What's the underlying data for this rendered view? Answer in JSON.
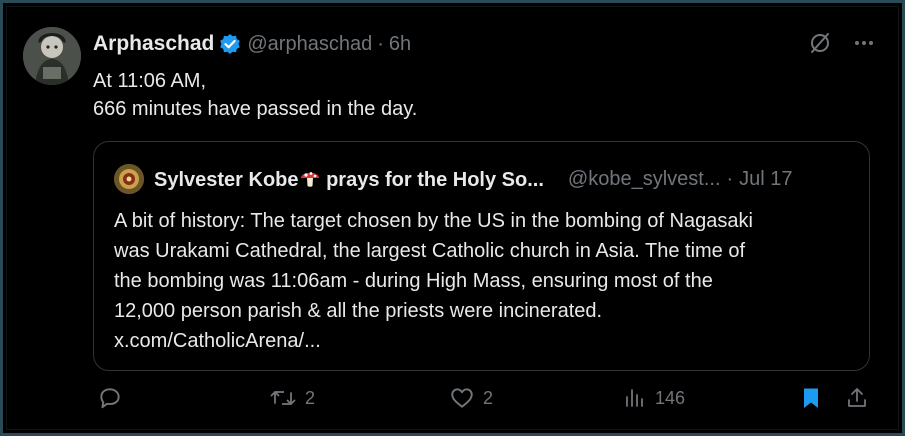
{
  "post": {
    "display_name": "Arphaschad",
    "handle": "@arphaschad",
    "separator": "·",
    "time": "6h",
    "text_line1": "At 11:06 AM,",
    "text_line2": "666 minutes have passed in the day."
  },
  "quote": {
    "display_name_before": "Sylvester Kobe",
    "display_name_after": " prays for the Holy So...",
    "handle": "@kobe_sylvest...",
    "separator": "·",
    "date": "Jul 17",
    "lines": [
      "A bit of history: The target chosen by the US in the bombing of Nagasaki",
      "was Urakami Cathedral, the largest Catholic church in Asia.  The time of",
      "the bombing was 11:06am - during High Mass, ensuring most of the",
      "12,000 person parish & all the priests were incinerated.",
      "x.com/CatholicArena/..."
    ]
  },
  "actions": {
    "reply_count": "",
    "repost_count": "2",
    "like_count": "2",
    "views_count": "146"
  },
  "colors": {
    "background": "#000000",
    "text": "#e7e9ea",
    "muted": "#71767b",
    "verified": "#1d9bf0",
    "bookmark": "#1d9bf0"
  },
  "icons": [
    "verified-badge-icon",
    "grok-icon",
    "more-icon",
    "mushroom-emoji-icon",
    "reply-icon",
    "repost-icon",
    "like-icon",
    "views-icon",
    "bookmark-icon",
    "share-icon"
  ]
}
